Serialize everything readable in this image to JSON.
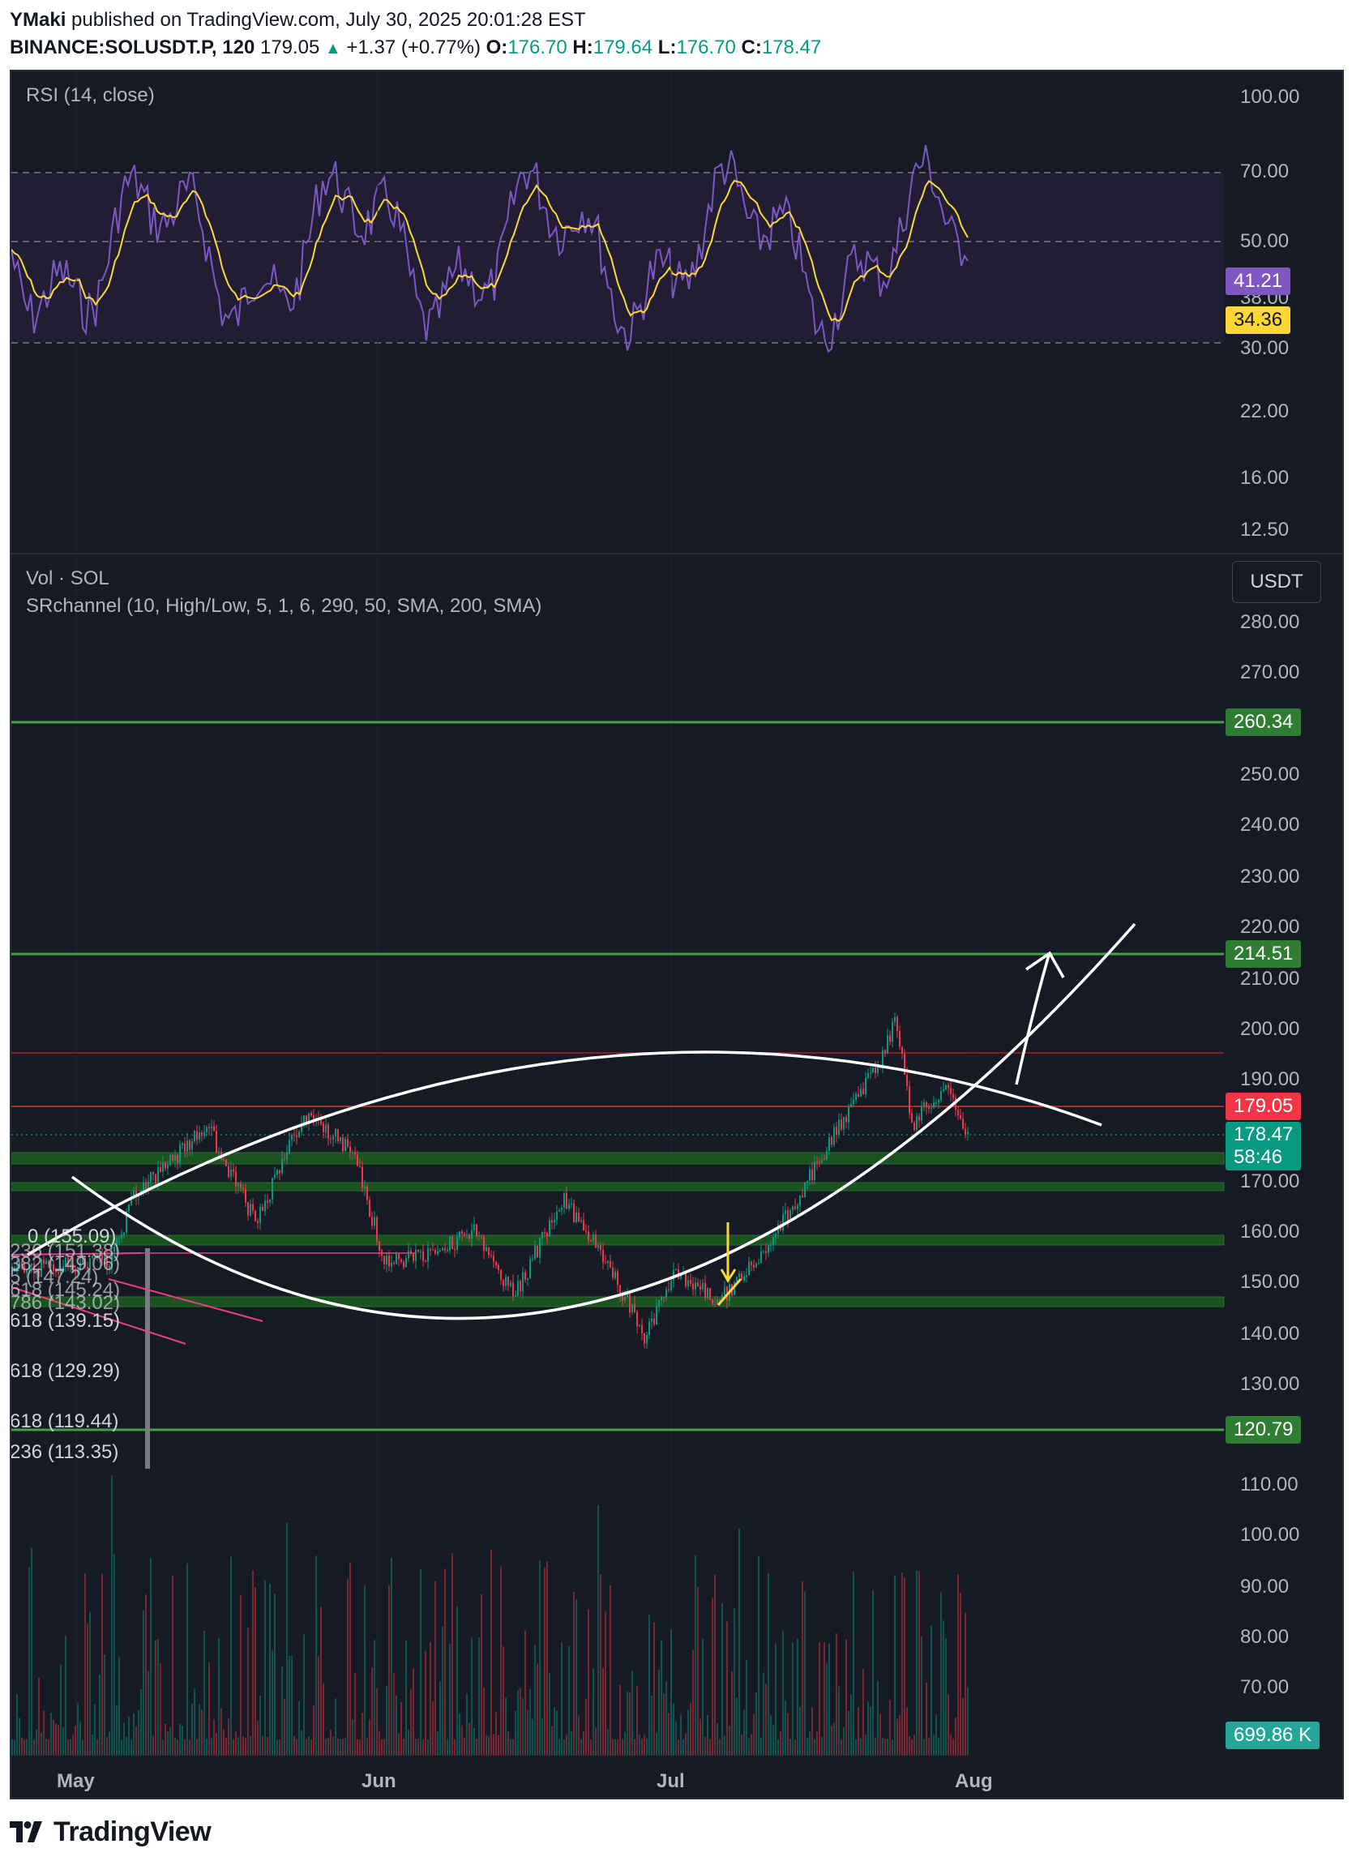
{
  "header": {
    "author": "YMaki",
    "published_text": "published on TradingView.com, July 30, 2025 20:01:28 EST",
    "symbol": "BINANCE:SOLUSDT.P, 120",
    "last": "179.05",
    "change": "+1.37 (+0.77%)",
    "o_label": "O:",
    "o_value": "176.70",
    "h_label": "H:",
    "h_value": "179.64",
    "l_label": "L:",
    "l_value": "176.70",
    "c_label": "C:",
    "c_value": "178.47"
  },
  "rsi_pane": {
    "title": "RSI (14, close)",
    "ticks": [
      "100.00",
      "70.00",
      "50.00",
      "38.00",
      "30.00",
      "22.00",
      "16.00",
      "12.50"
    ],
    "rsi_tag": "41.21",
    "ma_tag": "34.36",
    "colors": {
      "rsi": "#7e57c2",
      "ma": "#fdd835"
    }
  },
  "price_pane": {
    "vol_title": "Vol · SOL",
    "srchannel_title": "SRchannel (10, High/Low, 5, 1, 6, 290, 50, SMA, 200, SMA)",
    "currency": "USDT",
    "ticks": [
      "280.00",
      "270.00",
      "250.00",
      "240.00",
      "230.00",
      "220.00",
      "210.00",
      "200.00",
      "190.00",
      "170.00",
      "160.00",
      "150.00",
      "140.00",
      "130.00",
      "110.00",
      "100.00",
      "90.00",
      "80.00",
      "70.00"
    ],
    "tags": {
      "level_260": "260.34",
      "level_214": "214.51",
      "last_price": "179.05",
      "close_price": "178.47",
      "countdown": "58:46",
      "level_120": "120.79",
      "volume": "699.86 K"
    },
    "fib_labels": [
      "0 (155.09)",
      "236 (151.38)",
      "382 (149.06)",
      "5 (147.24)",
      "618 (145.24)",
      "786 (143.02)",
      "618 (139.15)",
      "618 (129.29)",
      "618 (119.44)",
      "236 (113.35)"
    ],
    "months": [
      "May",
      "Jun",
      "Jul",
      "Aug"
    ],
    "colors": {
      "up": "#089981",
      "down": "#f23645",
      "support": "#43a047",
      "resistance": "#c2185b"
    }
  },
  "footer": {
    "brand": "TradingView"
  }
}
